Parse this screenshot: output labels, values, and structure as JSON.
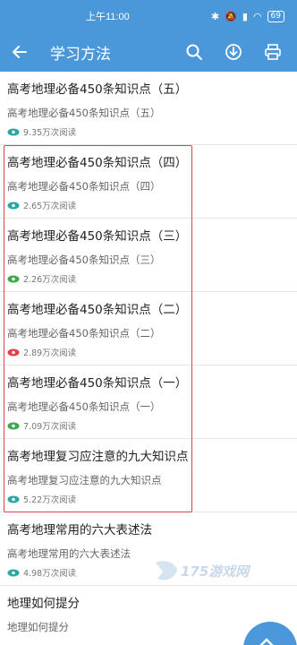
{
  "status": {
    "time": "上午11:00",
    "battery": "69"
  },
  "header": {
    "title": "学习方法",
    "icons": [
      "back-arrow-icon",
      "search-icon",
      "download-icon",
      "print-icon"
    ]
  },
  "articles": [
    {
      "title": "高考地理必备450条知识点（五）",
      "subtitle": "高考地理必备450条知识点（五）",
      "views": "9.35万次阅读",
      "eye_color": "#2aa7a0"
    },
    {
      "title": "高考地理必备450条知识点（四）",
      "subtitle": "高考地理必备450条知识点（四）",
      "views": "2.65万次阅读",
      "eye_color": "#2aa7a0"
    },
    {
      "title": "高考地理必备450条知识点（三）",
      "subtitle": "高考地理必备450条知识点（三）",
      "views": "2.26万次阅读",
      "eye_color": "#3aaa4a"
    },
    {
      "title": "高考地理必备450条知识点（二）",
      "subtitle": "高考地理必备450条知识点（二）",
      "views": "2.89万次阅读",
      "eye_color": "#e0414b"
    },
    {
      "title": "高考地理必备450条知识点（一）",
      "subtitle": "高考地理必备450条知识点（一）",
      "views": "7.09万次阅读",
      "eye_color": "#3aaa4a"
    },
    {
      "title": "高考地理复习应注意的九大知识点",
      "subtitle": "高考地理复习应注意的九大知识点",
      "views": "5.22万次阅读",
      "eye_color": "#2aa7a0"
    },
    {
      "title": "高考地理常用的六大表述法",
      "subtitle": "高考地理常用的六大表述法",
      "views": "4.98万次阅读",
      "eye_color": "#2aa7a0"
    },
    {
      "title": "地理如何提分",
      "subtitle": "地理如何提分",
      "views": "",
      "eye_color": "#2aa7a0"
    }
  ],
  "watermark": "175游戏网",
  "colors": {
    "primary": "#4a98d9",
    "highlight": "#e0414b"
  }
}
